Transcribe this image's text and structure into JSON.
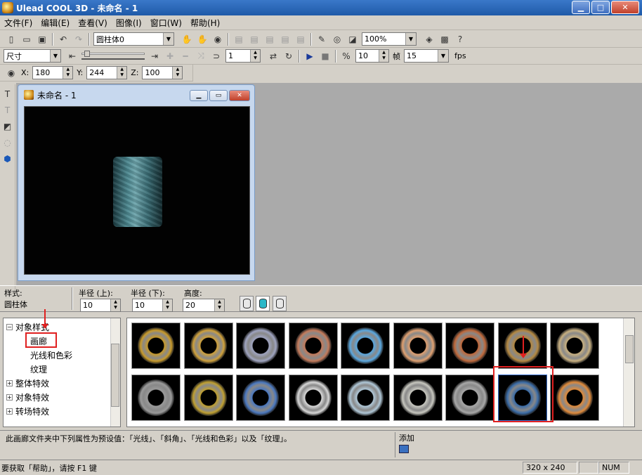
{
  "window": {
    "title": "Ulead COOL 3D - 未命名 - 1"
  },
  "menu": [
    "文件(F)",
    "编辑(E)",
    "查看(V)",
    "图像(I)",
    "窗口(W)",
    "帮助(H)"
  ],
  "toolbar": {
    "object_combo": "圆柱体0",
    "zoom_combo": "100%",
    "mode_combo": "尺寸",
    "frame_value": "1",
    "fps_frames": "10",
    "frame_label": "帧",
    "fps_value": "15",
    "fps_label": "fps"
  },
  "position": {
    "x_label": "X:",
    "x": "180",
    "y_label": "Y:",
    "y": "244",
    "z_label": "Z:",
    "z": "100"
  },
  "document": {
    "title": "未命名 - 1"
  },
  "properties": {
    "style_label": "样式:",
    "style_value": "圆柱体",
    "radius_top_label": "半径 (上):",
    "radius_top": "10",
    "radius_bottom_label": "半径 (下):",
    "radius_bottom": "10",
    "height_label": "高度:",
    "height": "20"
  },
  "tree": {
    "object_style": "对象样式",
    "gallery": "画廊",
    "light_color": "光线和色彩",
    "texture": "纹理",
    "overall_effects": "整体特效",
    "object_effects": "对象特效",
    "transition_effects": "转场特效"
  },
  "gallery": {
    "colors": [
      "#c89a2a",
      "#d0a13a",
      "#9fa4c0",
      "#c47a5a",
      "#5aa8e0",
      "#e0a070",
      "#c0683a",
      "#b48840",
      "#c8b080",
      "#9a9a9a",
      "#c0a030",
      "#4a78c0",
      "#d8d8d8",
      "#b0c8d8",
      "#c8c8c0",
      "#a8a8a8",
      "#3a6ca8",
      "#e08a3a"
    ]
  },
  "description": {
    "text": "此画廊文件夹中下列属性为预设值：「光线」、「斜角」、「光线和色彩」以及「纹理」。",
    "add_label": "添加"
  },
  "status": {
    "help": "要获取「帮助」，请按 F1 键",
    "size": "320 x 240",
    "num": "NUM"
  }
}
